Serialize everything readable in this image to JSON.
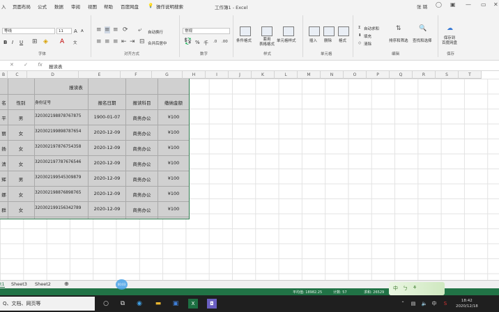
{
  "titlebar": {
    "left_tab": "入",
    "tabs": [
      "页面布局",
      "公式",
      "数据",
      "审阅",
      "视图",
      "帮助",
      "百度网盘"
    ],
    "tell_me": "操作说明搜索",
    "title": "工作簿1 - Excel",
    "user": "张 璐",
    "minimize_icon": "—",
    "restore_icon": "▭",
    "close_icon": "✕"
  },
  "ribbon": {
    "font_name": "等线",
    "font_size": "11",
    "font_a_up": "A",
    "font_a_down": "A",
    "bold": "B",
    "italic": "I",
    "underline": "U",
    "wrap_text": "自动换行",
    "merge_center": "合并后居中",
    "number_format": "常规",
    "percent": "%",
    "comma": "千",
    "cond_format": "条件格式",
    "table_format": "套用\n表格格式",
    "cell_styles": "单元格样式",
    "insert": "插入",
    "delete": "删除",
    "format": "格式",
    "autosum": "自动求和",
    "fill": "填充",
    "clear": "清除",
    "sort_filter": "排序和筛选",
    "find_select": "查找和选择",
    "save_baidu": "保存到\n百度网盘",
    "groups": {
      "font": "字体",
      "alignment": "对齐方式",
      "number": "数字",
      "styles": "样式",
      "cells": "单元格",
      "editing": "编辑",
      "save": "保存"
    }
  },
  "formula_bar": {
    "cancel": "✕",
    "enter": "✓",
    "fx": "fx",
    "content": "报读表"
  },
  "columns": [
    "B",
    "C",
    "D",
    "E",
    "F",
    "G",
    "H",
    "I",
    "J",
    "K",
    "L",
    "M",
    "N",
    "O",
    "P",
    "Q",
    "R",
    "S",
    "T"
  ],
  "table": {
    "title": "报读表",
    "headers": [
      "名",
      "性别",
      "身份证号",
      "报名日期",
      "报读科目",
      "缴纳金额"
    ],
    "rows": [
      [
        "平",
        "男",
        "320302198878767875",
        "1900-01-07",
        "商务办公",
        "¥100"
      ],
      [
        "丽",
        "女",
        "320302199898787654",
        "2020-12-09",
        "商务办公",
        "¥100"
      ],
      [
        "扬",
        "女",
        "320302197876754358",
        "2020-12-09",
        "商务办公",
        "¥100"
      ],
      [
        "清",
        "女",
        "320302197787676546",
        "2020-12-09",
        "商务办公",
        "¥100"
      ],
      [
        "辉",
        "男",
        "320302199545309879",
        "2020-12-09",
        "商务办公",
        "¥100"
      ],
      [
        "娜",
        "女",
        "320302198876898765",
        "2020-12-09",
        "商务办公",
        "¥100"
      ],
      [
        "群",
        "女",
        "320302199156342789",
        "2020-12-09",
        "商务办公",
        "¥100"
      ]
    ]
  },
  "sheets": [
    "t1",
    "Sheet3",
    "Sheet2"
  ],
  "add_sheet": "⊕",
  "status": {
    "average": "平均值: 18982.25",
    "count": "计数: 57",
    "sum": "求和: 26529"
  },
  "taskbar": {
    "search": "在这里输入你要搜索的内容，文档，网页等",
    "search_visible": "Q、文档、网页等",
    "time": "18:42",
    "date": "2020/12/18",
    "lang": "中"
  },
  "cursor_label": "00:03",
  "ime": [
    "中",
    "ㄅ",
    "⚘"
  ]
}
